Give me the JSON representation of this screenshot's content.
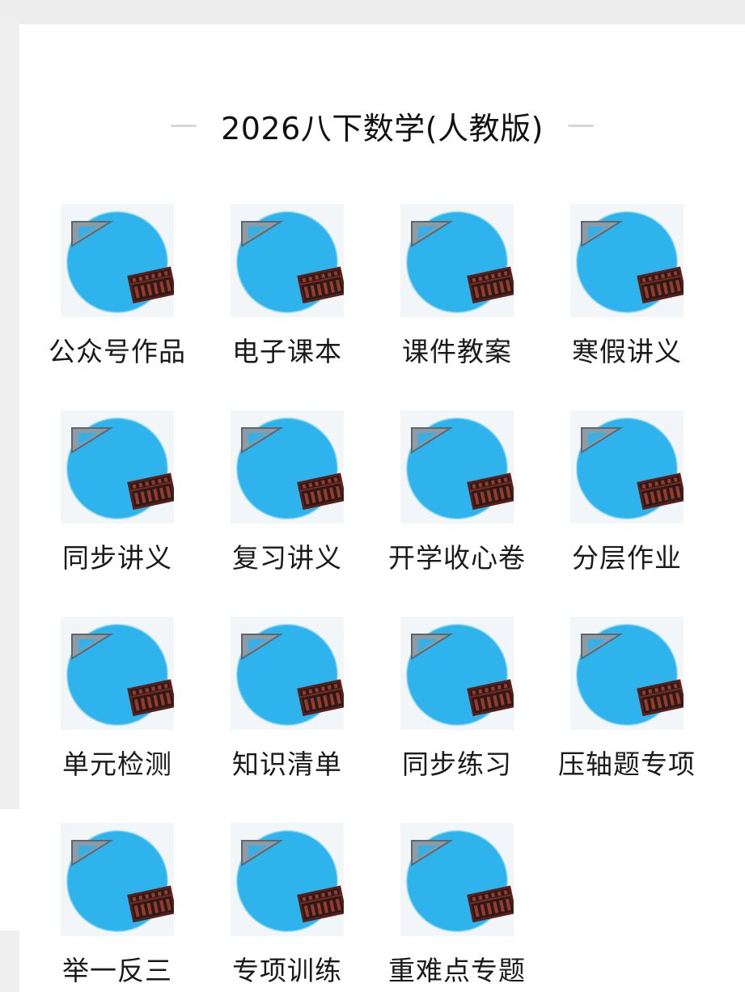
{
  "title": "2026八下数学(人教版)",
  "icon": {
    "name": "math-abacus-icon",
    "text": "数学",
    "circle_color": "#2fb3ec",
    "tile_bg": "#f3f6f8"
  },
  "items": [
    {
      "label": "公众号作品"
    },
    {
      "label": "电子课本"
    },
    {
      "label": "课件教案"
    },
    {
      "label": "寒假讲义"
    },
    {
      "label": "同步讲义"
    },
    {
      "label": "复习讲义"
    },
    {
      "label": "开学收心卷"
    },
    {
      "label": "分层作业"
    },
    {
      "label": "单元检测"
    },
    {
      "label": "知识清单"
    },
    {
      "label": "同步练习"
    },
    {
      "label": "压轴题专项"
    },
    {
      "label": "举一反三"
    },
    {
      "label": "专项训练"
    },
    {
      "label": "重难点专题"
    }
  ]
}
